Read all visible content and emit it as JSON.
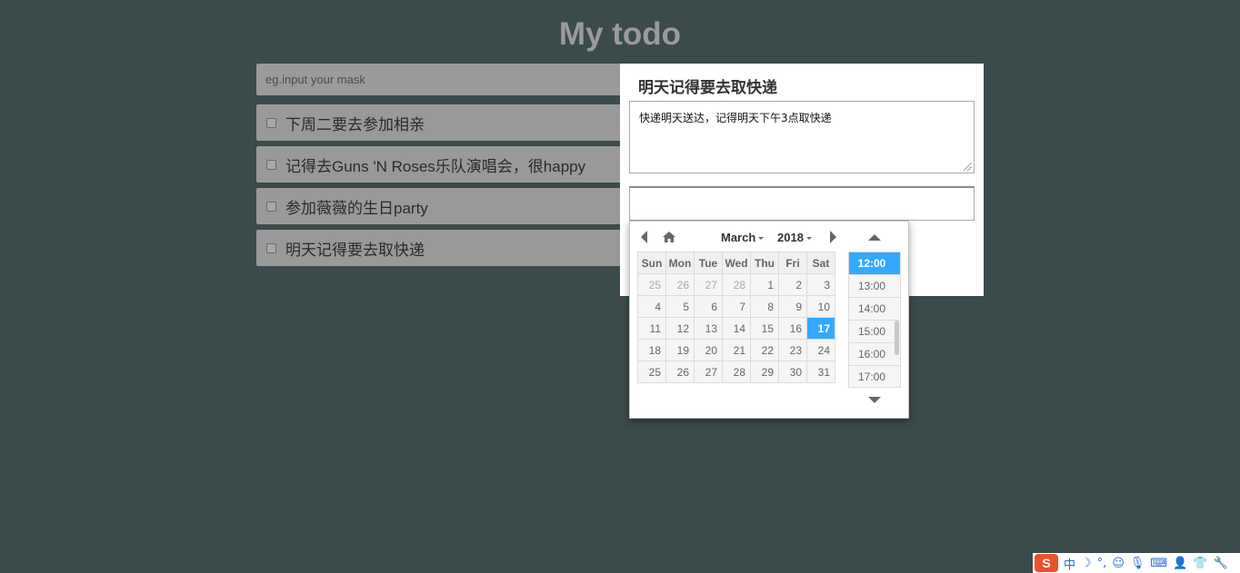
{
  "app": {
    "title": "My todo"
  },
  "new_task": {
    "placeholder": "eg.input your mask"
  },
  "todos": [
    {
      "text": "下周二要去参加相亲",
      "checked": false
    },
    {
      "text": "记得去Guns 'N Roses乐队演唱会，很happy",
      "checked": false
    },
    {
      "text": "参加薇薇的生日party",
      "checked": false
    },
    {
      "text": "明天记得要去取快递",
      "checked": false
    }
  ],
  "detail": {
    "title": "明天记得要去取快递",
    "description": "快递明天送达，记得明天下午3点取快递",
    "date_value": ""
  },
  "datetimepicker": {
    "month": "March",
    "year": "2018",
    "weekdays": [
      "Sun",
      "Mon",
      "Tue",
      "Wed",
      "Thu",
      "Fri",
      "Sat"
    ],
    "weeks": [
      [
        {
          "d": "25",
          "o": true
        },
        {
          "d": "26",
          "o": true
        },
        {
          "d": "27",
          "o": true
        },
        {
          "d": "28",
          "o": true
        },
        {
          "d": "1"
        },
        {
          "d": "2"
        },
        {
          "d": "3"
        }
      ],
      [
        {
          "d": "4"
        },
        {
          "d": "5"
        },
        {
          "d": "6"
        },
        {
          "d": "7"
        },
        {
          "d": "8"
        },
        {
          "d": "9"
        },
        {
          "d": "10"
        }
      ],
      [
        {
          "d": "11"
        },
        {
          "d": "12"
        },
        {
          "d": "13"
        },
        {
          "d": "14"
        },
        {
          "d": "15"
        },
        {
          "d": "16"
        },
        {
          "d": "17",
          "s": true
        }
      ],
      [
        {
          "d": "18"
        },
        {
          "d": "19"
        },
        {
          "d": "20"
        },
        {
          "d": "21"
        },
        {
          "d": "22"
        },
        {
          "d": "23"
        },
        {
          "d": "24"
        }
      ],
      [
        {
          "d": "25"
        },
        {
          "d": "26"
        },
        {
          "d": "27"
        },
        {
          "d": "28"
        },
        {
          "d": "29"
        },
        {
          "d": "30"
        },
        {
          "d": "31"
        }
      ]
    ],
    "selected_date": "17",
    "times": [
      "12:00",
      "13:00",
      "14:00",
      "15:00",
      "16:00",
      "17:00"
    ],
    "selected_time": "12:00",
    "accent_color": "#33aaff"
  },
  "ime_toolbar": {
    "logo": "S",
    "items": [
      {
        "name": "chinese-mode",
        "glyph": "中"
      },
      {
        "name": "moon",
        "glyph": "☽"
      },
      {
        "name": "punctuation",
        "glyph": "°,"
      },
      {
        "name": "emoji",
        "glyph": "☺"
      },
      {
        "name": "microphone",
        "glyph": "🎙"
      },
      {
        "name": "keyboard",
        "glyph": "⌨"
      },
      {
        "name": "user",
        "glyph": "👤"
      },
      {
        "name": "skin",
        "glyph": "👕"
      },
      {
        "name": "settings",
        "glyph": "🔧"
      }
    ]
  }
}
